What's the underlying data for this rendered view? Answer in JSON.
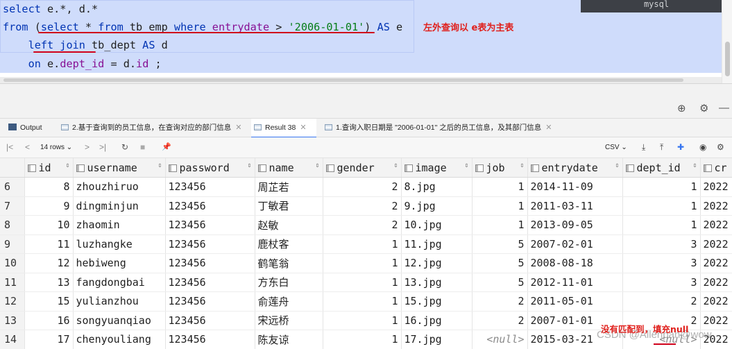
{
  "editor": {
    "lines": [
      {
        "kw1": "select",
        "t1": " e.*, d.*"
      },
      {
        "kw1": "from",
        "t1": " (",
        "kw2": "select",
        "t2": " * ",
        "kw3": "from",
        "t3": " tb_emp ",
        "kw4": "where",
        "t4": " ",
        "f1": "entrydate",
        "t5": " > ",
        "s1": "'2006-01-01'",
        "t6": ") ",
        "kw5": "AS",
        "t7": " e"
      },
      {
        "kw1": "left join",
        "t1": " tb_dept ",
        "kw2": "AS",
        "t2": " d"
      },
      {
        "kw1": "on",
        "t1": " e.",
        "f1": "dept_id",
        "t2": " = d.",
        "f2": "id",
        "t3": " ;"
      }
    ],
    "annotation": "左外查询以 e表为主表",
    "db_tag": "mysql"
  },
  "tabs": [
    {
      "label": "Output"
    },
    {
      "label": "2.基于查询到的员工信息，在查询对应的部门信息"
    },
    {
      "label": "Result 38"
    },
    {
      "label": "1.查询入职日期是 \"2006-01-01\" 之后的员工信息，及其部门信息"
    }
  ],
  "toolbar": {
    "rows_label": "14 rows",
    "export_format": "CSV"
  },
  "icons": {
    "first": "|<",
    "prev": "<",
    "next": ">",
    "last": ">|",
    "refresh": "↻",
    "stop": "■",
    "pin": "📌",
    "download": "⤓",
    "upload": "⤒",
    "view": "◉",
    "settings": "⚙",
    "services": "⊕",
    "gear": "⚙",
    "minimize": "—"
  },
  "table": {
    "columns": [
      "id",
      "username",
      "password",
      "name",
      "gender",
      "image",
      "job",
      "entrydate",
      "dept_id",
      "cr"
    ],
    "rows": [
      {
        "rn": "6",
        "id": "8",
        "username": "zhouzhiruo",
        "password": "123456",
        "name": "周芷若",
        "gender": "2",
        "image": "8.jpg",
        "job": "1",
        "entrydate": "2014-11-09",
        "dept_id": "1",
        "cr": "2022"
      },
      {
        "rn": "7",
        "id": "9",
        "username": "dingminjun",
        "password": "123456",
        "name": "丁敏君",
        "gender": "2",
        "image": "9.jpg",
        "job": "1",
        "entrydate": "2011-03-11",
        "dept_id": "1",
        "cr": "2022"
      },
      {
        "rn": "8",
        "id": "10",
        "username": "zhaomin",
        "password": "123456",
        "name": "赵敏",
        "gender": "2",
        "image": "10.jpg",
        "job": "1",
        "entrydate": "2013-09-05",
        "dept_id": "1",
        "cr": "2022"
      },
      {
        "rn": "9",
        "id": "11",
        "username": "luzhangke",
        "password": "123456",
        "name": "鹿杖客",
        "gender": "1",
        "image": "11.jpg",
        "job": "5",
        "entrydate": "2007-02-01",
        "dept_id": "3",
        "cr": "2022"
      },
      {
        "rn": "10",
        "id": "12",
        "username": "hebiweng",
        "password": "123456",
        "name": "鹤笔翁",
        "gender": "1",
        "image": "12.jpg",
        "job": "5",
        "entrydate": "2008-08-18",
        "dept_id": "3",
        "cr": "2022"
      },
      {
        "rn": "11",
        "id": "13",
        "username": "fangdongbai",
        "password": "123456",
        "name": "方东白",
        "gender": "1",
        "image": "13.jpg",
        "job": "5",
        "entrydate": "2012-11-01",
        "dept_id": "3",
        "cr": "2022"
      },
      {
        "rn": "12",
        "id": "15",
        "username": "yulianzhou",
        "password": "123456",
        "name": "俞莲舟",
        "gender": "1",
        "image": "15.jpg",
        "job": "2",
        "entrydate": "2011-05-01",
        "dept_id": "2",
        "cr": "2022"
      },
      {
        "rn": "13",
        "id": "16",
        "username": "songyuanqiao",
        "password": "123456",
        "name": "宋远桥",
        "gender": "1",
        "image": "16.jpg",
        "job": "2",
        "entrydate": "2007-01-01",
        "dept_id": "2",
        "cr": "2022"
      },
      {
        "rn": "14",
        "id": "17",
        "username": "chenyouliang",
        "password": "123456",
        "name": "陈友谅",
        "gender": "1",
        "image": "17.jpg",
        "job": "<null>",
        "entrydate": "2015-03-21",
        "dept_id": "<null>",
        "cr": "2022"
      }
    ]
  },
  "note": "没有匹配到，填充null",
  "watermark": "CSDN @Allenpan@wow",
  "colors": {
    "keyword": "#0033b3",
    "string": "#067d17",
    "field": "#871094",
    "selection": "#cfdcfb",
    "annotation": "#e0201c"
  }
}
